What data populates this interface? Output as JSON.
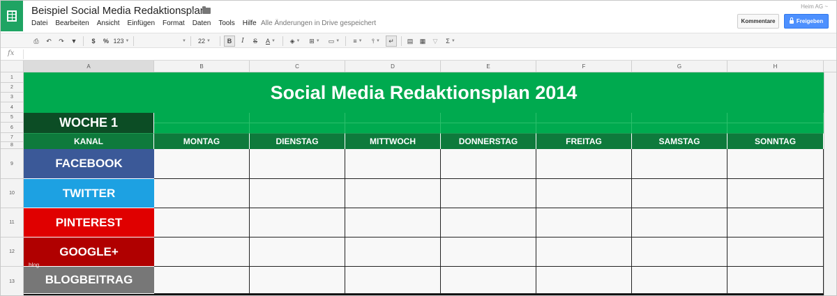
{
  "app": {
    "title": "Beispiel Social Media Redaktionsplan",
    "user": "Heim AG ~",
    "save_status": "Alle Änderungen in Drive gespeichert",
    "buttons": {
      "comments": "Kommentare",
      "share": "Freigeben"
    },
    "accent_color": "#1fa463",
    "share_color": "#4d90fe"
  },
  "menu": [
    "Datei",
    "Bearbeiten",
    "Ansicht",
    "Einfügen",
    "Format",
    "Daten",
    "Tools",
    "Hilfe"
  ],
  "toolbar": {
    "currency": "$",
    "percent": "%",
    "number_format": "123",
    "font_size": "22",
    "bold": "B",
    "italic": "I",
    "strike": "S",
    "text_color": "A",
    "sum": "Σ"
  },
  "formula_bar": {
    "icon": "fx"
  },
  "columns": [
    "A",
    "B",
    "C",
    "D",
    "E",
    "F",
    "G",
    "H"
  ],
  "rows": [
    "1",
    "2",
    "3",
    "4",
    "5",
    "6",
    "7",
    "8",
    "9",
    "10",
    "11",
    "12",
    "13"
  ],
  "sheet": {
    "title": "Social Media Redaktionsplan 2014",
    "week": "WOCHE 1",
    "channel_header": "KANAL",
    "days": [
      "MONTAG",
      "DIENSTAG",
      "MITTWOCH",
      "DONNERSTAG",
      "FREITAG",
      "SAMSTAG",
      "SONNTAG"
    ],
    "channels": [
      {
        "name": "FACEBOOK",
        "color": "#3b5998"
      },
      {
        "name": "TWITTER",
        "color": "#1da1e2"
      },
      {
        "name": "PINTEREST",
        "color": "#e00000"
      },
      {
        "name": "GOOGLE+",
        "color": "#b00000"
      },
      {
        "name": "BLOGBEITRAG",
        "color": "#777777"
      }
    ],
    "watermark": "blog",
    "title_color": "#00aa4f",
    "week_color": "#0c4d25",
    "days_color": "#0e7a3c"
  }
}
